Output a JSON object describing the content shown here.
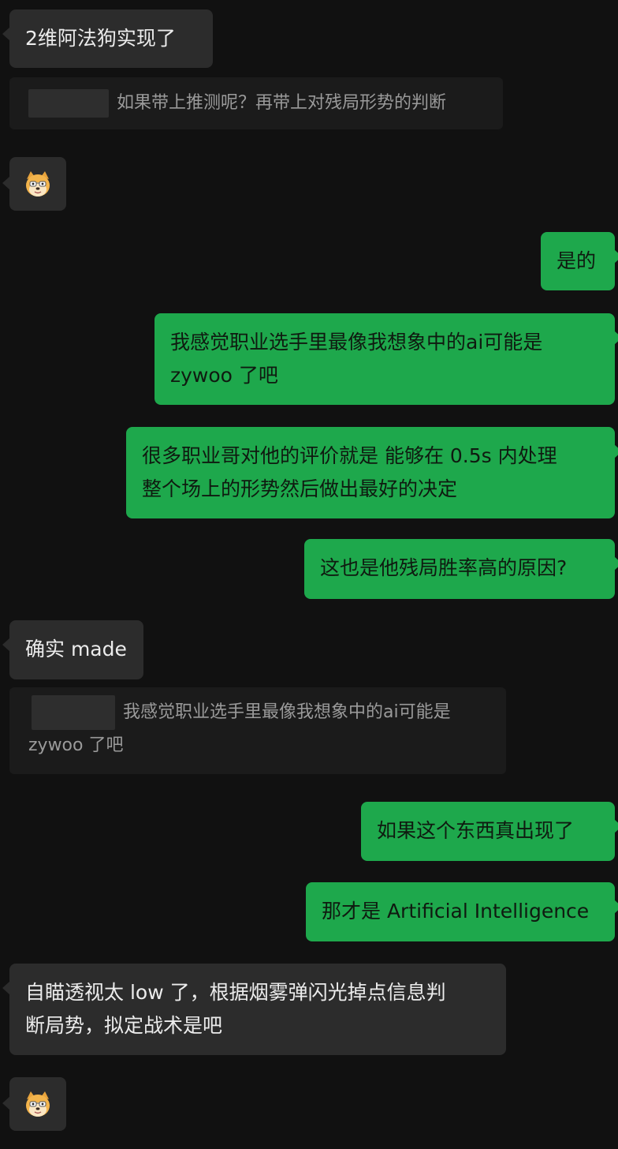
{
  "messages": [
    {
      "text": "2维阿法狗实现了"
    },
    {
      "quote": "如果带上推测呢？再带上对残局形势的判断"
    },
    {
      "emoji": "doge-emoji"
    },
    {
      "text": "是的"
    },
    {
      "text": "我感觉职业选手里最像我想象中的ai可能是\nzywoo 了吧"
    },
    {
      "text": "很多职业哥对他的评价就是 能够在 0.5s 内处理\n整个场上的形势然后做出最好的决定"
    },
    {
      "text": "这也是他残局胜率高的原因?"
    },
    {
      "text": "确实 made"
    },
    {
      "quote": "我感觉职业选手里最像我想象中的ai可能是\nzywoo 了吧"
    },
    {
      "text": "如果这个东西真出现了"
    },
    {
      "text": "那才是 Artificial Intelligence"
    },
    {
      "text": "自瞄透视太 low 了，根据烟雾弹闪光掉点信息判\n断局势，拟定战术是吧"
    },
    {
      "emoji": "doge-emoji"
    }
  ],
  "colors": {
    "background": "#111111",
    "incoming": "#2c2c2c",
    "outgoing": "#1ea84c",
    "quote": "#1b1b1b"
  }
}
